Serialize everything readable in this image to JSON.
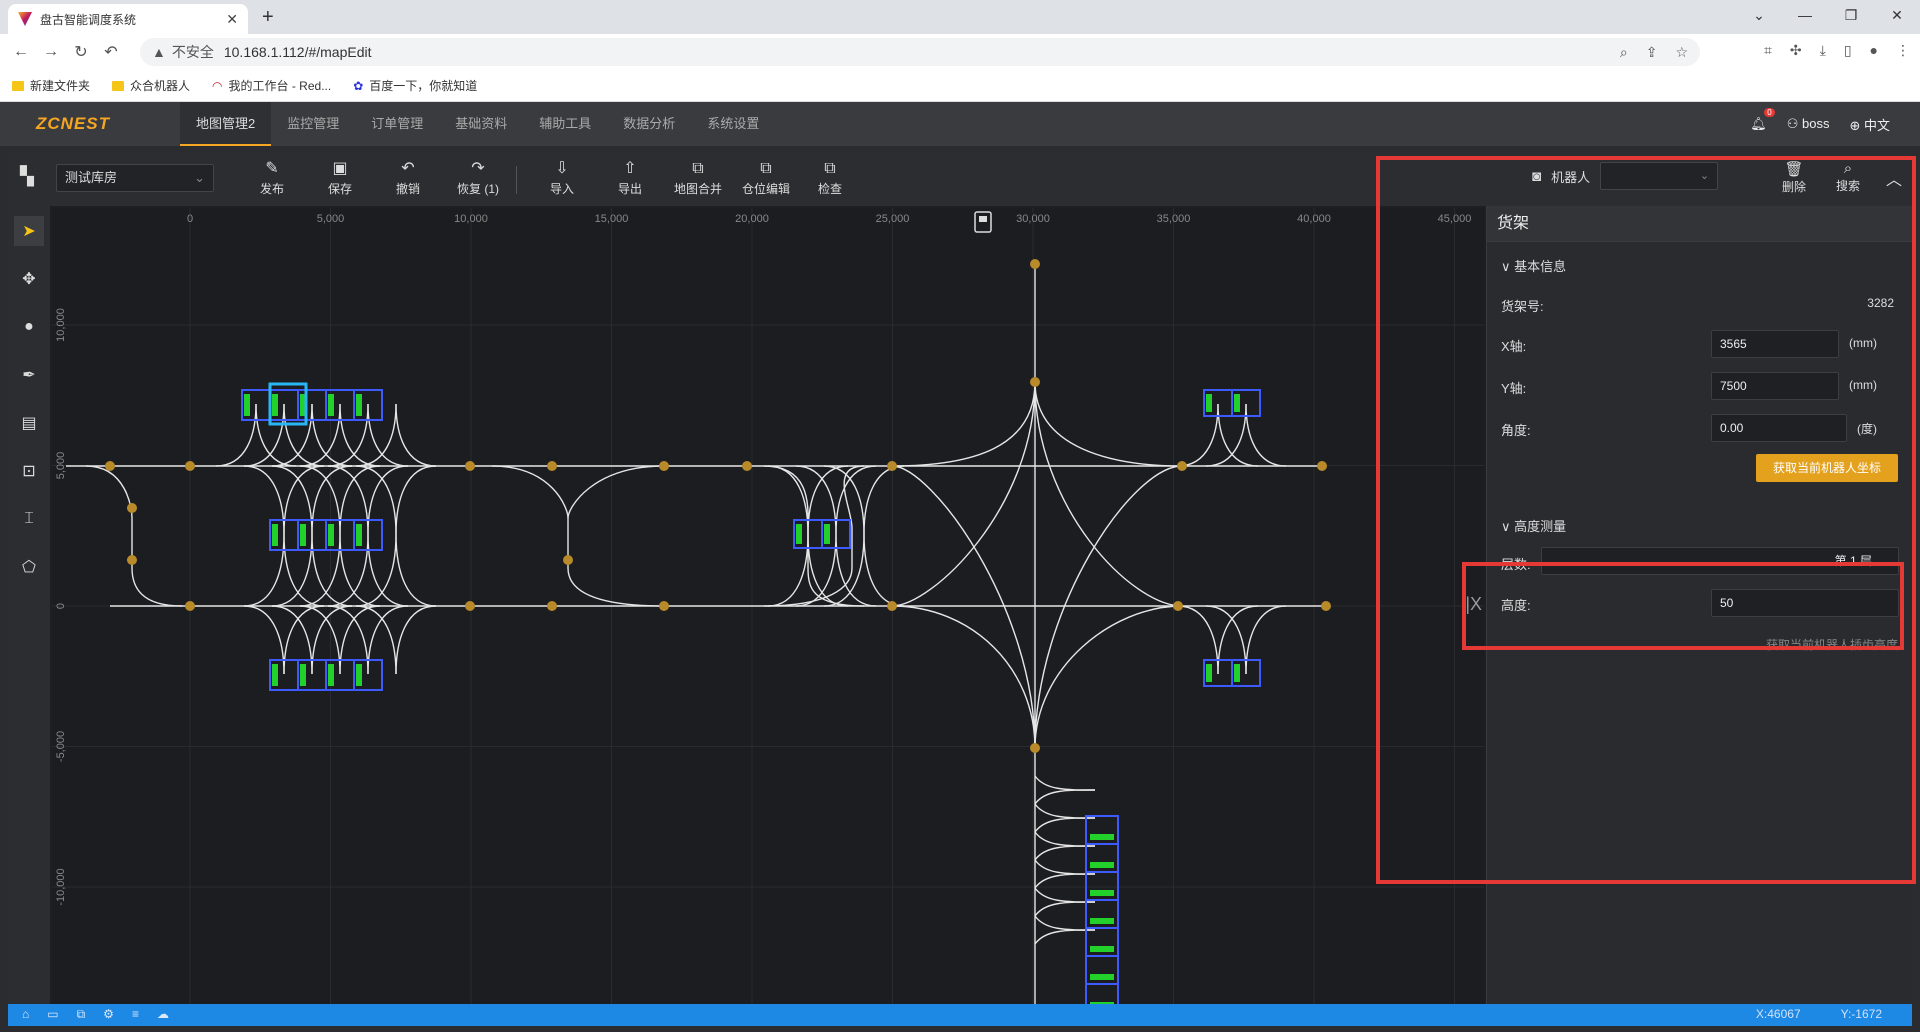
{
  "browser": {
    "tab_title": "盘古智能调度系统",
    "url": "10.168.1.112/#/mapEdit",
    "insecure_label": "不安全",
    "bookmarks": [
      "新建文件夹",
      "众合机器人",
      "我的工作台 - Red...",
      "百度一下，你就知道"
    ]
  },
  "app": {
    "logo": "ZCNEST",
    "menus": [
      "地图管理2",
      "监控管理",
      "订单管理",
      "基础资料",
      "辅助工具",
      "数据分析",
      "系统设置"
    ],
    "notification_count": "0",
    "user": "boss",
    "language": "中文"
  },
  "toolbar": {
    "warehouse": "测试库房",
    "tools": [
      "发布",
      "保存",
      "撤销",
      "恢复 (1)",
      "导入",
      "导出",
      "地图合并",
      "仓位编辑",
      "检查"
    ],
    "robot_label": "机器人",
    "delete_label": "删除",
    "search_label": "搜索"
  },
  "map": {
    "x_ticks": [
      "0",
      "5,000",
      "10,000",
      "15,000",
      "20,000",
      "25,000",
      "30,000",
      "35,000",
      "40,000",
      "45,000"
    ],
    "y_ticks": [
      "10,000",
      "5,000",
      "0",
      "-5,000",
      "-10,000"
    ]
  },
  "panel": {
    "title": "货架",
    "basic_info": "基本信息",
    "shelf_no_label": "货架号:",
    "shelf_no": "3282",
    "x_label": "X轴:",
    "x_value": "3565",
    "x_unit": "(mm)",
    "y_label": "Y轴:",
    "y_value": "7500",
    "y_unit": "(mm)",
    "angle_label": "角度:",
    "angle_value": "0.00",
    "angle_unit": "(度)",
    "get_coords_btn": "获取当前机器人坐标",
    "height_section": "高度测量",
    "layer_label": "层数:",
    "layer_value": "第 1 层",
    "height_label": "高度:",
    "height_value": "50",
    "get_height_link": "获取当前机器人插齿高度"
  },
  "status": {
    "x": "X:46067",
    "y": "Y:-1672"
  },
  "colors": {
    "accent": "#f5a623",
    "highlight_box": "#e53935",
    "shelf_border": "#3d5afe",
    "shelf_fill": "#22d12a",
    "node": "#b88a2a",
    "statusbar": "#1e88e5"
  }
}
